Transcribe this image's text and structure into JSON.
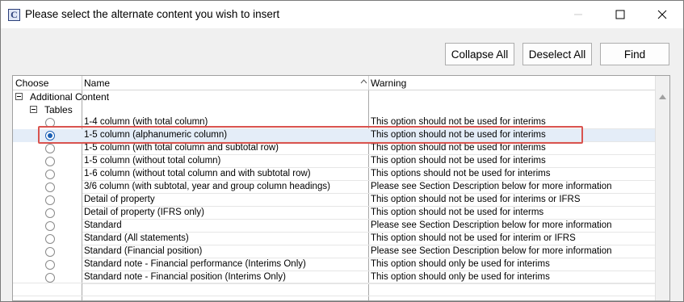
{
  "window": {
    "title": "Please select the alternate content you wish to insert",
    "app_icon_letter": "C"
  },
  "toolbar": {
    "collapse_all": "Collapse All",
    "deselect_all": "Deselect All",
    "find": "Find"
  },
  "grid": {
    "columns": {
      "choose": "Choose",
      "name": "Name",
      "warning": "Warning"
    },
    "group_label": "Additional Content",
    "subgroup_label": "Tables",
    "rows": [
      {
        "name": "1-4 column (with total column)",
        "warning": "This option should not be used for interims",
        "selected": false
      },
      {
        "name": "1-5 column (alphanumeric column)",
        "warning": "This option should not be used for interims",
        "selected": true
      },
      {
        "name": "1-5 column (with total column and subtotal row)",
        "warning": "This option should not be used for interims",
        "selected": false
      },
      {
        "name": "1-5 column (without total column)",
        "warning": "This option should not be used for interims",
        "selected": false
      },
      {
        "name": "1-6 column (without total column and with subtotal row)",
        "warning": "This options should not be used for interims",
        "selected": false
      },
      {
        "name": "3/6 column (with subtotal, year and group column headings)",
        "warning": "Please see Section Description below for more information",
        "selected": false
      },
      {
        "name": "Detail of property",
        "warning": "This option should not be used for interims or IFRS",
        "selected": false
      },
      {
        "name": "Detail of property (IFRS only)",
        "warning": "This option should not be used for interms",
        "selected": false
      },
      {
        "name": "Standard",
        "warning": "Please see Section Description below for more information",
        "selected": false
      },
      {
        "name": "Standard (All statements)",
        "warning": "This option should not be used for interim or IFRS",
        "selected": false
      },
      {
        "name": "Standard (Financial position)",
        "warning": "Please see Section Description below for more information",
        "selected": false
      },
      {
        "name": "Standard note - Financial performance (Interims Only)",
        "warning": "This option should only be used for interims",
        "selected": false
      },
      {
        "name": "Standard note - Financial position (Interims Only)",
        "warning": "This option should only be used for interims",
        "selected": false
      }
    ]
  },
  "colors": {
    "highlight": "#d9534f",
    "radio_selected": "#1a5fb4",
    "selected_row_bg": "#e4edf8"
  }
}
